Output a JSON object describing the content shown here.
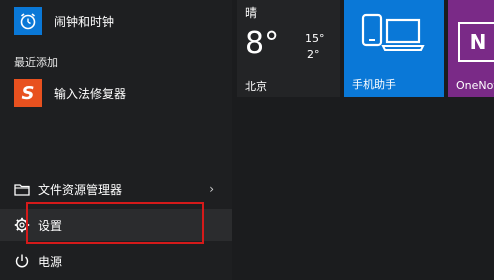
{
  "start_menu": {
    "top_apps": [
      {
        "label": "闹钟和时钟",
        "icon": "alarm-clock-icon",
        "color": "#0a78d7"
      }
    ],
    "recent_header": "最近添加",
    "recent_apps": [
      {
        "label": "输入法修复器",
        "icon": "sogou-s-icon",
        "color": "#e8511f"
      }
    ],
    "system": {
      "file_explorer": "文件资源管理器",
      "settings": "设置",
      "power": "电源"
    }
  },
  "tiles": {
    "weather": {
      "condition": "晴",
      "temp": "8°",
      "high": "15°",
      "low": "2°",
      "city": "北京"
    },
    "phone_companion": {
      "label": "手机助手",
      "color": "#0a78d7",
      "icon": "phone-laptop-icon"
    },
    "onenote": {
      "label": "OneNote",
      "color": "#7a2a87",
      "icon": "onenote-icon"
    }
  },
  "highlight_color": "#d51a1a"
}
